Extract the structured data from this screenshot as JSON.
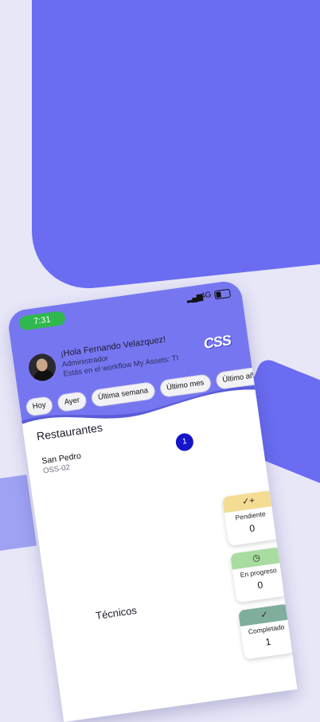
{
  "status_bar": {
    "time": "7:31",
    "signal": "▂▄▆",
    "network": "4G"
  },
  "header": {
    "greeting": "¡Hola Fernando Velazquez!",
    "role": "Administrador",
    "workflow_text": "Estás en el workflow My Assets: TI",
    "logo_text": "CSS"
  },
  "filters": [
    "Hoy",
    "Ayer",
    "Última semana",
    "Último mes",
    "Último año"
  ],
  "restaurants": {
    "title": "Restaurantes",
    "item": {
      "name": "San Pedro",
      "code": "OSS-02",
      "count": "1"
    }
  },
  "stats": [
    {
      "label": "Pendiente",
      "value": "0",
      "icon": "✓+",
      "color": "#f4dc93"
    },
    {
      "label": "En progreso",
      "value": "0",
      "icon": "◷",
      "color": "#a8dca0"
    },
    {
      "label": "Completado",
      "value": "1",
      "icon": "✓",
      "color": "#7fae9c"
    }
  ],
  "technicians_title": "Técnicos",
  "colors": {
    "header": "#7677f0",
    "accent": "#1414c8",
    "time_pill": "#2fb84d"
  }
}
